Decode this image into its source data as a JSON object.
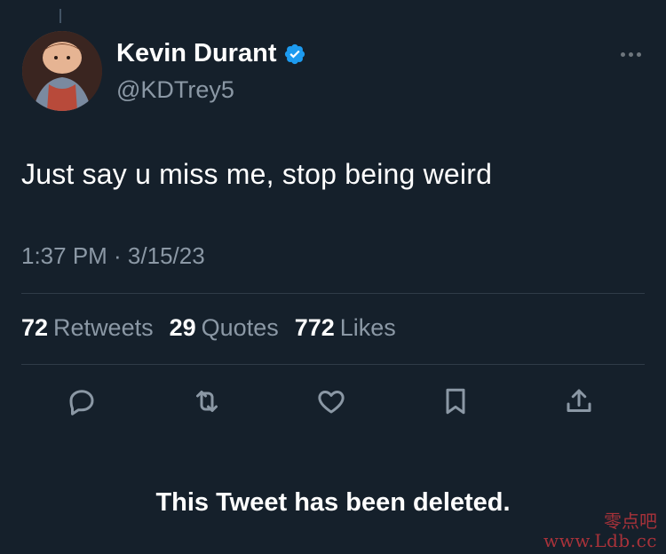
{
  "author": {
    "display_name": "Kevin Durant",
    "handle": "@KDTrey5",
    "verified": true
  },
  "tweet": {
    "text": "Just say u miss me, stop being weird",
    "timestamp": "1:37 PM · 3/15/23"
  },
  "stats": [
    {
      "count": "72",
      "label": "Retweets"
    },
    {
      "count": "29",
      "label": "Quotes"
    },
    {
      "count": "772",
      "label": "Likes"
    }
  ],
  "actions": [
    "reply-icon",
    "retweet-icon",
    "like-icon",
    "bookmark-icon",
    "share-icon"
  ],
  "notice": "This Tweet has been deleted.",
  "watermark": {
    "top": "零点吧",
    "bottom": "www.Ldb.cc"
  },
  "colors": {
    "background": "#15202b",
    "verified": "#1d9bf0",
    "secondary_text": "#8b98a5",
    "icon": "#8b98a5"
  }
}
